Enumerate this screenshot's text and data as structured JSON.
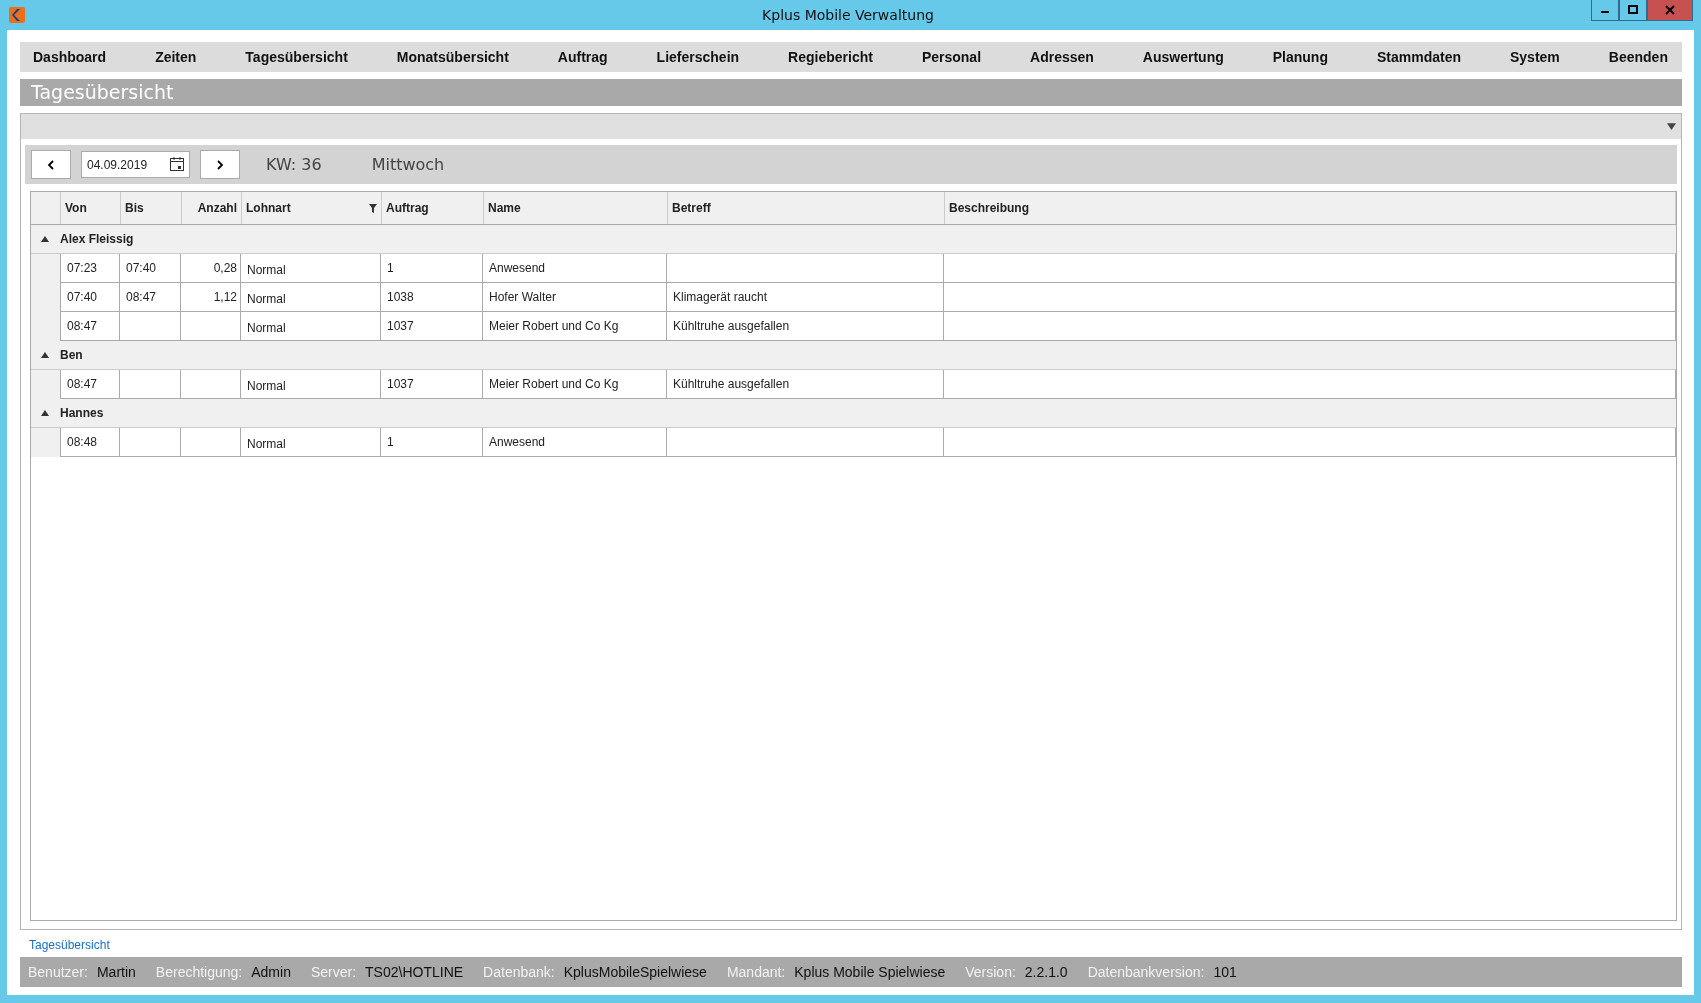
{
  "window": {
    "title": "Kplus Mobile Verwaltung"
  },
  "menu": [
    {
      "label": "Dashboard"
    },
    {
      "label": "Zeiten"
    },
    {
      "label": "Tagesübersicht"
    },
    {
      "label": "Monatsübersicht"
    },
    {
      "label": "Auftrag"
    },
    {
      "label": "Lieferschein"
    },
    {
      "label": "Regiebericht"
    },
    {
      "label": "Personal"
    },
    {
      "label": "Adressen"
    },
    {
      "label": "Auswertung"
    },
    {
      "label": "Planung"
    },
    {
      "label": "Stammdaten"
    },
    {
      "label": "System"
    },
    {
      "label": "Beenden"
    }
  ],
  "page_title": "Tagesübersicht",
  "toolbar": {
    "date": "04.09.2019",
    "week": "KW: 36",
    "weekday": "Mittwoch"
  },
  "table": {
    "columns": [
      {
        "label": "Von",
        "filter": false
      },
      {
        "label": "Bis",
        "filter": false
      },
      {
        "label": "Anzahl",
        "filter": false
      },
      {
        "label": "Lohnart",
        "filter": true
      },
      {
        "label": "Auftrag",
        "filter": false
      },
      {
        "label": "Name",
        "filter": false
      },
      {
        "label": "Betreff",
        "filter": false
      },
      {
        "label": "Beschreibung",
        "filter": false
      }
    ],
    "groups": [
      {
        "name": "Alex Fleissig",
        "expanded": true,
        "rows": [
          {
            "cells": [
              "07:23",
              "07:40",
              "0,28",
              "Normal",
              "1",
              "Anwesend",
              null,
              null
            ]
          },
          {
            "cells": [
              "07:40",
              "08:47",
              "1,12",
              "Normal",
              "1038",
              "Hofer Walter",
              "Klimagerät raucht",
              null
            ]
          },
          {
            "cells": [
              "08:47",
              null,
              null,
              "Normal",
              "1037",
              "Meier Robert und Co Kg",
              "Kühltruhe ausgefallen",
              null
            ]
          }
        ]
      },
      {
        "name": "Ben",
        "expanded": true,
        "rows": [
          {
            "cells": [
              "08:47",
              null,
              null,
              "Normal",
              "1037",
              "Meier Robert und Co Kg",
              "Kühltruhe ausgefallen",
              null
            ]
          }
        ]
      },
      {
        "name": "Hannes",
        "expanded": true,
        "rows": [
          {
            "cells": [
              "08:48",
              null,
              null,
              "Normal",
              "1",
              "Anwesend",
              null,
              null
            ]
          }
        ]
      }
    ]
  },
  "footer_link": "Tagesübersicht",
  "status_bar": [
    {
      "label": "Benutzer:",
      "value": "Martin"
    },
    {
      "label": "Berechtigung:",
      "value": "Admin"
    },
    {
      "label": "Server:",
      "value": "TS02\\HOTLINE"
    },
    {
      "label": "Datenbank:",
      "value": "KplusMobileSpielwiese"
    },
    {
      "label": "Mandant:",
      "value": "Kplus Mobile Spielwiese"
    },
    {
      "label": "Version:",
      "value": "2.2.1.0"
    },
    {
      "label": "Datenbankversion:",
      "value": "101"
    }
  ]
}
